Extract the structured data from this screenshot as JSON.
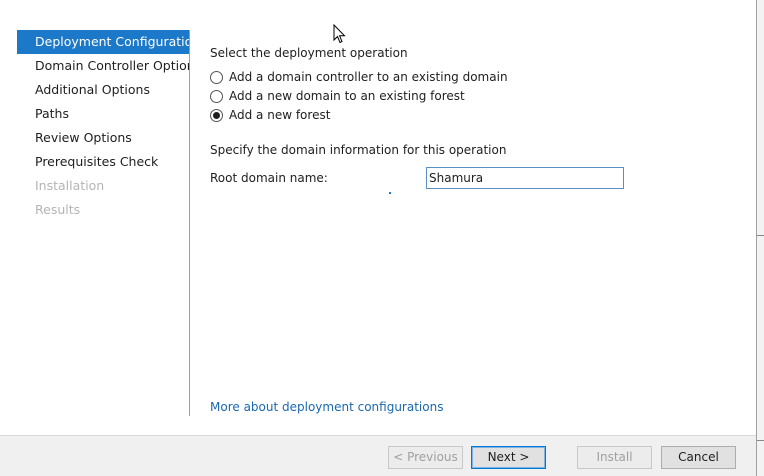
{
  "sidebar": {
    "items": [
      {
        "label": "Deployment Configuration",
        "state": "active"
      },
      {
        "label": "Domain Controller Options",
        "state": "normal"
      },
      {
        "label": "Additional Options",
        "state": "normal"
      },
      {
        "label": "Paths",
        "state": "normal"
      },
      {
        "label": "Review Options",
        "state": "normal"
      },
      {
        "label": "Prerequisites Check",
        "state": "normal"
      },
      {
        "label": "Installation",
        "state": "disabled"
      },
      {
        "label": "Results",
        "state": "disabled"
      }
    ]
  },
  "main": {
    "operation_heading": "Select the deployment operation",
    "options": [
      {
        "label": "Add a domain controller to an existing domain",
        "checked": false
      },
      {
        "label": "Add a new domain to an existing forest",
        "checked": false
      },
      {
        "label": "Add a new forest",
        "checked": true
      }
    ],
    "domain_heading": "Specify the domain information for this operation",
    "root_domain_label": "Root domain name:",
    "root_domain_value": "Shamura",
    "more_link": "More about deployment configurations"
  },
  "footer": {
    "previous_label": "< Previous",
    "next_label": "Next >",
    "install_label": "Install",
    "cancel_label": "Cancel"
  },
  "colors": {
    "accent": "#1c78c8",
    "link": "#1a68b0",
    "disabled_text": "#b4b4b4"
  }
}
